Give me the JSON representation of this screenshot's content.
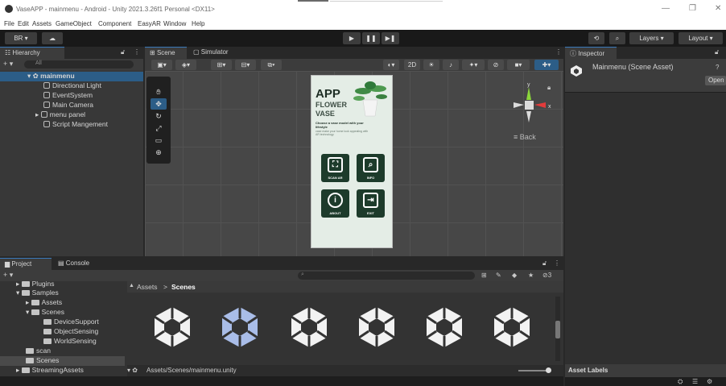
{
  "window": {
    "title": "VaseAPP - mainmenu - Android - Unity 2021.3.26f1 Personal <DX11>",
    "minimize": "—",
    "maximize": "❐",
    "close": "✕"
  },
  "menu": [
    "File",
    "Edit",
    "Assets",
    "GameObject",
    "Component",
    "EasyAR",
    "Window",
    "Help"
  ],
  "toolbar": {
    "account": "BR ▾",
    "cloud": "☁",
    "play": "▶",
    "pause": "❚❚",
    "step": "▶❚",
    "layers_label": "Layers",
    "layout_label": "Layout"
  },
  "hierarchy": {
    "tab": "Hierarchy",
    "add": "+ ▾",
    "search_placeholder": "All",
    "items": [
      {
        "label": "mainmenu"
      },
      {
        "label": "Directional Light"
      },
      {
        "label": "EventSystem"
      },
      {
        "label": "Main Camera"
      },
      {
        "label": "menu panel"
      },
      {
        "label": "Script Mangement"
      }
    ]
  },
  "scene": {
    "tab_scene": "Scene",
    "tab_simulator": "Simulator",
    "toggle_2d": "2D",
    "back_label": "≡ Back",
    "axis_x": "x",
    "axis_y": "y"
  },
  "app": {
    "title": "APP",
    "subtitle1": "FLOWER",
    "subtitle2": "VASE",
    "tagline": "Choose a vase model with your lifestyle",
    "desc": "vase make your home look appealing with AR technology",
    "buttons": [
      {
        "label": "SCAN AR",
        "icon": "⛶"
      },
      {
        "label": "INFO",
        "icon": "⌕"
      },
      {
        "label": "ABOUT",
        "icon": "i"
      },
      {
        "label": "EXIT",
        "icon": "⇥"
      }
    ]
  },
  "inspector": {
    "tab": "Inspector",
    "title": "Mainmenu (Scene Asset)",
    "open": "Open",
    "asset_labels": "Asset Labels"
  },
  "project": {
    "tab_project": "Project",
    "tab_console": "Console",
    "add": "+ ▾",
    "search_placeholder": "",
    "breadcrumb_root": "Assets",
    "breadcrumb_sep": ">",
    "breadcrumb_leaf": "Scenes",
    "path": "Assets/Scenes/mainmenu.unity",
    "count_badge": "3",
    "tree": [
      {
        "label": "Plugins"
      },
      {
        "label": "Samples"
      },
      {
        "label": "Assets"
      },
      {
        "label": "Scenes"
      },
      {
        "label": "DeviceSupport"
      },
      {
        "label": "ObjectSensing"
      },
      {
        "label": "WorldSensing"
      },
      {
        "label": "scan"
      },
      {
        "label": "Scenes"
      },
      {
        "label": "StreamingAssets"
      }
    ]
  },
  "colors": {
    "accent": "#2c5d87",
    "panel": "#383838",
    "app_green": "#1d3b2b"
  }
}
